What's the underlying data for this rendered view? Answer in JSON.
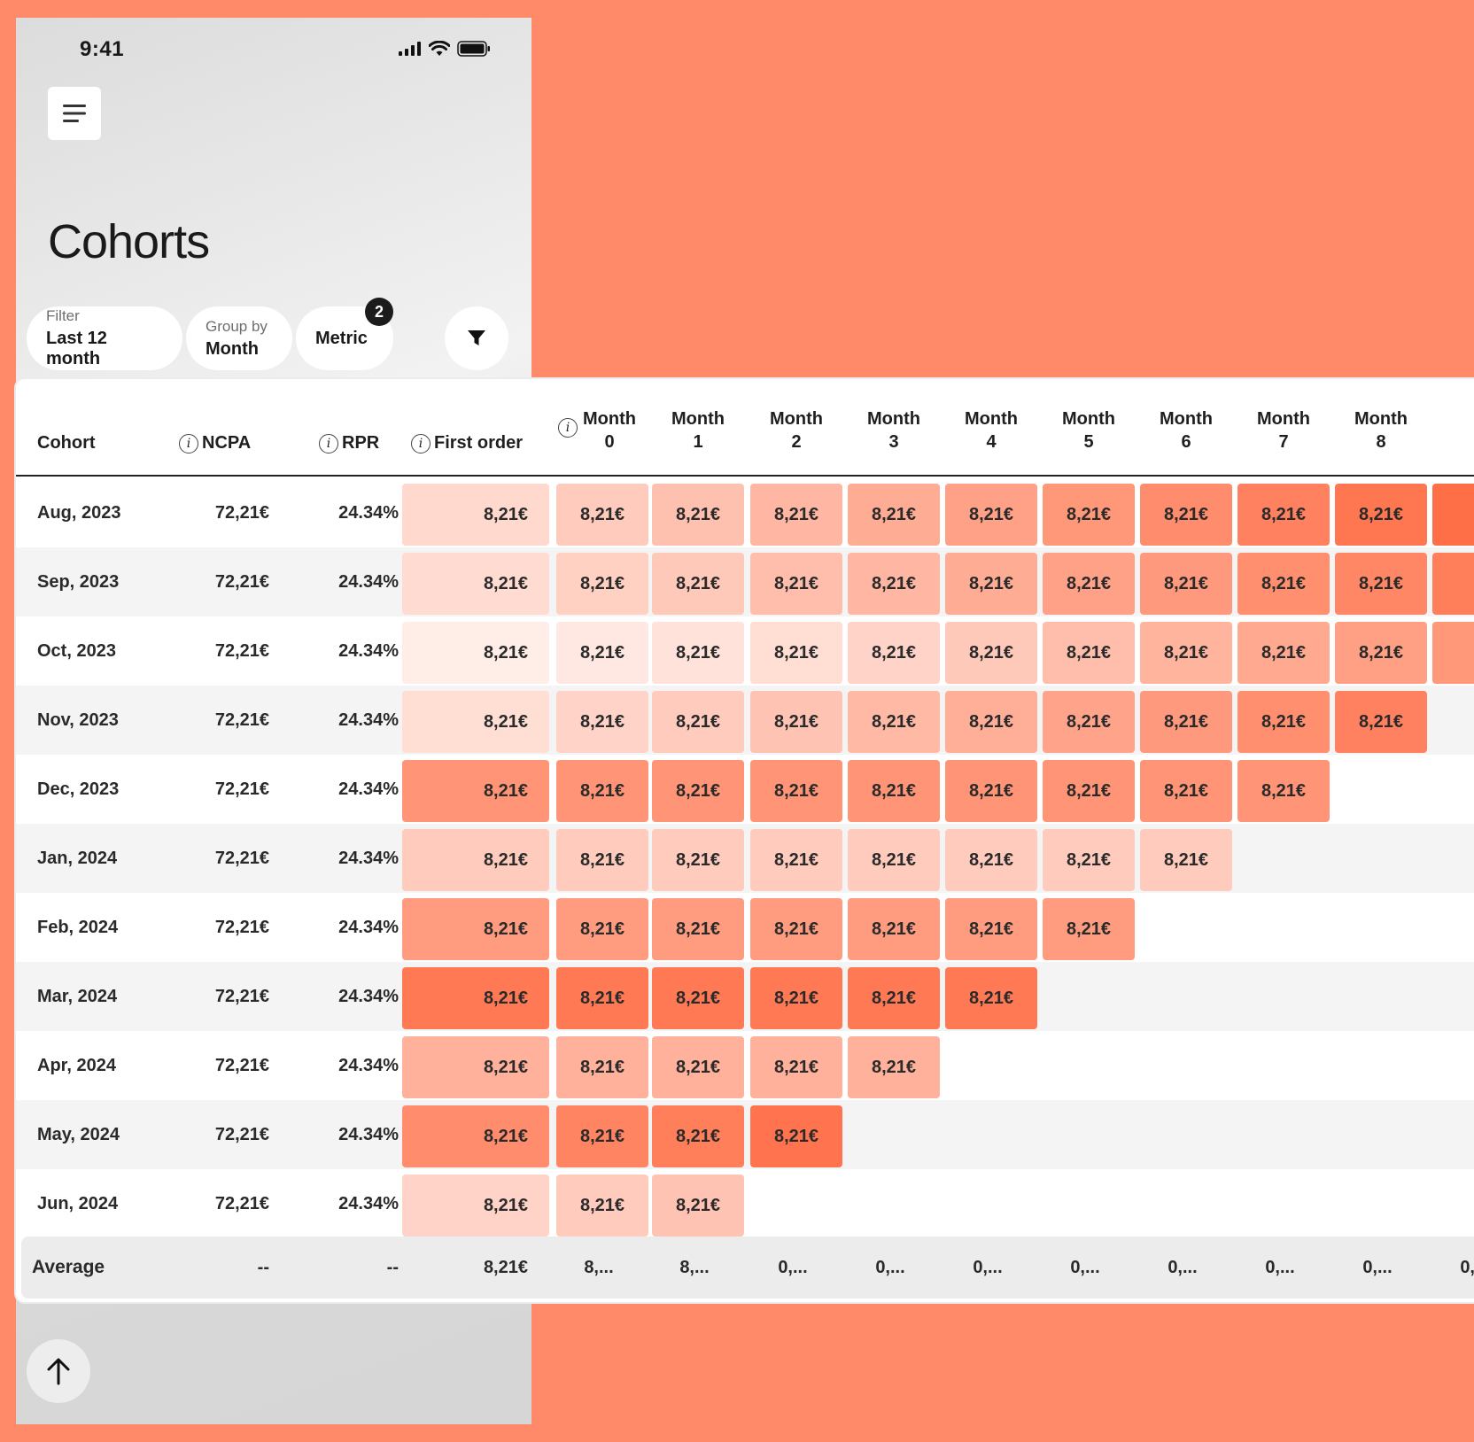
{
  "status": {
    "time": "9:41"
  },
  "page": {
    "title": "Cohorts"
  },
  "chips": {
    "filter": {
      "label": "Filter",
      "value": "Last 12 month"
    },
    "group": {
      "label": "Group by",
      "value": "Month"
    },
    "metric": {
      "value": "Metric",
      "badge": "2"
    }
  },
  "table": {
    "headers": {
      "cohort": "Cohort",
      "ncpa": "NCPA",
      "rpr": "RPR",
      "first_order": "First order",
      "month_word": "Month",
      "months": [
        "0",
        "1",
        "2",
        "3",
        "4",
        "5",
        "6",
        "7",
        "8"
      ]
    },
    "rows": [
      {
        "cohort": "Aug, 2023",
        "ncpa": "72,21€",
        "rpr": "24.34%",
        "first": "8,21€",
        "values": [
          "8,21€",
          "8,21€",
          "8,21€",
          "8,21€",
          "8,21€",
          "8,21€",
          "8,21€",
          "8,21€",
          "8,21€"
        ],
        "extra": ""
      },
      {
        "cohort": "Sep, 2023",
        "ncpa": "72,21€",
        "rpr": "24.34%",
        "first": "8,21€",
        "values": [
          "8,21€",
          "8,21€",
          "8,21€",
          "8,21€",
          "8,21€",
          "8,21€",
          "8,21€",
          "8,21€",
          "8,21€"
        ],
        "extra": ""
      },
      {
        "cohort": "Oct, 2023",
        "ncpa": "72,21€",
        "rpr": "24.34%",
        "first": "8,21€",
        "values": [
          "8,21€",
          "8,21€",
          "8,21€",
          "8,21€",
          "8,21€",
          "8,21€",
          "8,21€",
          "8,21€",
          "8,21€"
        ],
        "extra": ""
      },
      {
        "cohort": "Nov, 2023",
        "ncpa": "72,21€",
        "rpr": "24.34%",
        "first": "8,21€",
        "values": [
          "8,21€",
          "8,21€",
          "8,21€",
          "8,21€",
          "8,21€",
          "8,21€",
          "8,21€",
          "8,21€",
          "8,21€"
        ]
      },
      {
        "cohort": "Dec, 2023",
        "ncpa": "72,21€",
        "rpr": "24.34%",
        "first": "8,21€",
        "values": [
          "8,21€",
          "8,21€",
          "8,21€",
          "8,21€",
          "8,21€",
          "8,21€",
          "8,21€",
          "8,21€"
        ]
      },
      {
        "cohort": "Jan, 2024",
        "ncpa": "72,21€",
        "rpr": "24.34%",
        "first": "8,21€",
        "values": [
          "8,21€",
          "8,21€",
          "8,21€",
          "8,21€",
          "8,21€",
          "8,21€",
          "8,21€"
        ]
      },
      {
        "cohort": "Feb, 2024",
        "ncpa": "72,21€",
        "rpr": "24.34%",
        "first": "8,21€",
        "values": [
          "8,21€",
          "8,21€",
          "8,21€",
          "8,21€",
          "8,21€",
          "8,21€"
        ]
      },
      {
        "cohort": "Mar, 2024",
        "ncpa": "72,21€",
        "rpr": "24.34%",
        "first": "8,21€",
        "values": [
          "8,21€",
          "8,21€",
          "8,21€",
          "8,21€",
          "8,21€"
        ]
      },
      {
        "cohort": "Apr, 2024",
        "ncpa": "72,21€",
        "rpr": "24.34%",
        "first": "8,21€",
        "values": [
          "8,21€",
          "8,21€",
          "8,21€",
          "8,21€"
        ]
      },
      {
        "cohort": "May, 2024",
        "ncpa": "72,21€",
        "rpr": "24.34%",
        "first": "8,21€",
        "values": [
          "8,21€",
          "8,21€",
          "8,21€"
        ]
      },
      {
        "cohort": "Jun, 2024",
        "ncpa": "72,21€",
        "rpr": "24.34%",
        "first": "8,21€",
        "values": [
          "8,21€",
          "8,21€"
        ]
      }
    ],
    "intensity": [
      [
        0.2,
        0.3,
        0.38,
        0.46,
        0.54,
        0.62,
        0.7,
        0.78,
        0.86,
        0.94,
        1.0
      ],
      [
        0.18,
        0.26,
        0.32,
        0.4,
        0.46,
        0.54,
        0.62,
        0.68,
        0.76,
        0.82,
        0.88
      ],
      [
        0.04,
        0.08,
        0.12,
        0.16,
        0.24,
        0.32,
        0.4,
        0.48,
        0.56,
        0.64,
        0.7
      ],
      [
        0.16,
        0.24,
        0.3,
        0.36,
        0.44,
        0.52,
        0.6,
        0.68,
        0.76,
        0.86
      ],
      [
        0.72,
        0.72,
        0.72,
        0.72,
        0.72,
        0.72,
        0.72,
        0.72,
        0.72
      ],
      [
        0.3,
        0.3,
        0.3,
        0.3,
        0.3,
        0.3,
        0.3,
        0.3
      ],
      [
        0.66,
        0.66,
        0.66,
        0.66,
        0.66,
        0.66,
        0.66
      ],
      [
        0.92,
        0.92,
        0.92,
        0.92,
        0.92,
        0.92
      ],
      [
        0.5,
        0.5,
        0.5,
        0.5,
        0.5
      ],
      [
        0.78,
        0.84,
        0.88,
        0.96
      ],
      [
        0.24,
        0.3,
        0.36
      ]
    ],
    "average": {
      "label": "Average",
      "ncpa": "--",
      "rpr": "--",
      "first": "8,21€",
      "values": [
        "8,...",
        "8,...",
        "0,...",
        "0,...",
        "0,...",
        "0,...",
        "0,...",
        "0,...",
        "0,...",
        "0,..."
      ]
    },
    "heat_color_low": "#FFF3EF",
    "heat_color_high": "#FF6F47"
  }
}
